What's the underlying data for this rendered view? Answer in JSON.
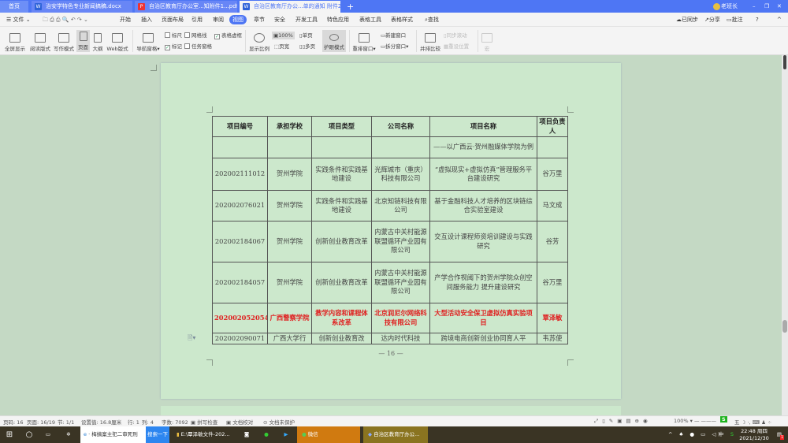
{
  "tabs": [
    {
      "label": "首页",
      "active": false
    },
    {
      "label": "治安学特色专业新闻搞稿.docx",
      "icon": "word-icon"
    },
    {
      "label": "自治区教育厅办公室...知附件1...pdf",
      "icon": "pdf-icon"
    },
    {
      "label": "自治区教育厅办公...单的通知 附件2",
      "icon": "word-icon",
      "active": true
    }
  ],
  "new_tab": "+",
  "user": {
    "name": "老班长"
  },
  "menu": {
    "file": "文件",
    "items": [
      "开始",
      "插入",
      "页面布局",
      "引用",
      "审阅",
      "视图",
      "章节",
      "安全",
      "开发工具",
      "特色应用",
      "表格工具",
      "表格样式"
    ],
    "active": "视图",
    "search": "查找",
    "sync": "已同步",
    "share": "分享",
    "comment": "批注",
    "help": "?"
  },
  "ribbon": {
    "big_buttons": [
      "全屏显示",
      "阅读版式",
      "写作模式",
      "页面",
      "大纲",
      "Web版式",
      "导航窗格",
      "显示比例",
      "护眼模式",
      "重排窗口",
      "并排比较",
      "宏"
    ],
    "checks": [
      {
        "label": "标尺",
        "checked": false
      },
      {
        "label": "网格线",
        "checked": false
      },
      {
        "label": "表格虚框",
        "checked": true
      },
      {
        "label": "标记",
        "checked": true
      },
      {
        "label": "任务窗格",
        "checked": false
      }
    ],
    "zoom_100": "100%",
    "page_width": "页宽",
    "single_page": "单页",
    "multi_page": "多页",
    "new_window": "新建窗口",
    "split_window": "拆分窗口",
    "sync_scroll": "同步滚动",
    "reset_pos": "重设位置"
  },
  "table": {
    "headers": [
      "项目编号",
      "承担学校",
      "项目类型",
      "公司名称",
      "项目名称",
      "项目负责人"
    ],
    "rows": [
      {
        "cells": [
          "",
          "",
          "",
          "",
          "——以广西云·贺州融媒体学院为例",
          ""
        ],
        "highlight": false
      },
      {
        "cells": [
          "202002111012",
          "贺州学院",
          "实践条件和实践基地建设",
          "光辉城市（重庆）科技有限公司",
          "“虚拟现实+虚拟仿真”管理服务平台建设研究",
          "谷万里"
        ],
        "highlight": false
      },
      {
        "cells": [
          "202002076021",
          "贺州学院",
          "实践条件和实践基地建设",
          "北京知链科技有限公司",
          "基于金融科技人才培养的区块链综合实验室建设",
          "马文成"
        ],
        "highlight": false
      },
      {
        "cells": [
          "202002184067",
          "贺州学院",
          "创新创业教育改革",
          "内蒙古中关村能源联盟循环产业园有限公司",
          "交互设计课程师资培训建设与实践研究",
          "谷芳"
        ],
        "highlight": false
      },
      {
        "cells": [
          "202002184057",
          "贺州学院",
          "创新创业教育改革",
          "内蒙古中关村能源联盟循环产业园有限公司",
          "产学合作视阈下的贺州学院众创空间服务能力 提升建设研究",
          "谷万里"
        ],
        "highlight": false
      },
      {
        "cells": [
          "202002052054",
          "广西警察学院",
          "教学内容和课程体系改革",
          "北京润尼尔网络科技有限公司",
          "大型活动安全保卫虚拟仿真实验项目",
          "覃泽敏"
        ],
        "highlight": true
      },
      {
        "cells": [
          "202002090071",
          "广西大学行",
          "创新创业教育改",
          "达内时代科技",
          "跨境电商创新创业协同育人平",
          "韦苏使"
        ],
        "highlight": false
      }
    ]
  },
  "page_number": "— 16 —",
  "status": {
    "page": "页码: 16",
    "pages": "页面: 16/19",
    "section": "节: 1/1",
    "setting": "设置值: 16.8厘米",
    "row": "行: 1",
    "col": "列: 4",
    "words": "字数: 7092",
    "spell": "拼写检查",
    "proof": "文档校对",
    "protect": "文档未保护",
    "zoom": "100%"
  },
  "taskbar": {
    "browser_tab": "梅姨案主犯二审死刑",
    "search_btn": "搜索一下",
    "folder": "E:\\覃泽敏文件-202...",
    "wechat": "微信",
    "wps": "自治区教育厅办公...",
    "ime": "中",
    "time": "22:48 周四",
    "date": "2021/12/30",
    "notif_count": "1"
  },
  "colors": {
    "tabbar": "#4e76f4",
    "eye_bg": "#cce8cc",
    "highlight_text": "#e02020",
    "taskbar": "#3a3424"
  }
}
